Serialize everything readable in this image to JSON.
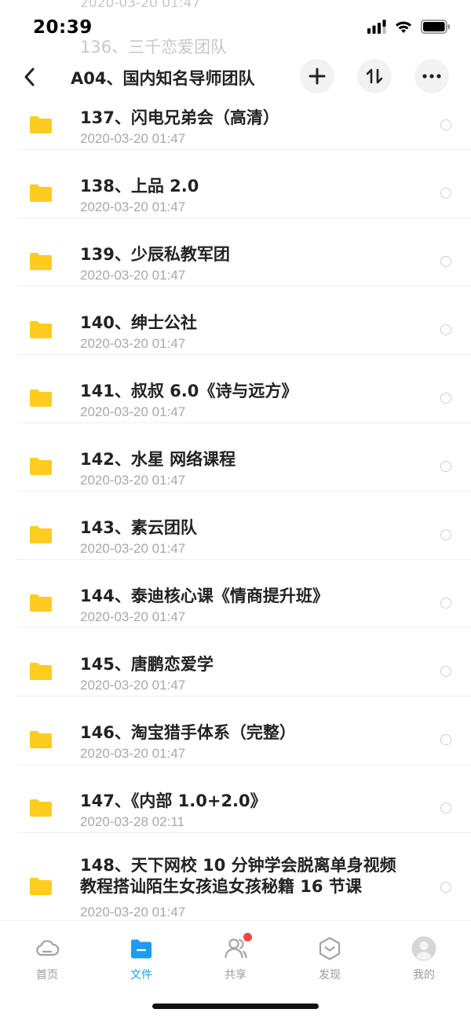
{
  "status_bar": {
    "time": "20:39"
  },
  "ghost_rows": {
    "top_date": "2020-03-20 01:47",
    "prev_item": "136、三千恋爱团队"
  },
  "header": {
    "title": "A04、国内知名导师团队"
  },
  "files": [
    {
      "name": "137、闪电兄弟会（高清）",
      "date": "2020-03-20 01:47"
    },
    {
      "name": "138、上品 2.0",
      "date": "2020-03-20 01:47"
    },
    {
      "name": "139、少辰私教军团",
      "date": "2020-03-20 01:47"
    },
    {
      "name": "140、绅士公社",
      "date": "2020-03-20 01:47"
    },
    {
      "name": "141、叔叔 6.0《诗与远方》",
      "date": "2020-03-20 01:47"
    },
    {
      "name": "142、水星 网络课程",
      "date": "2020-03-20 01:47"
    },
    {
      "name": "143、素云团队",
      "date": "2020-03-20 01:47"
    },
    {
      "name": "144、泰迪核心课《情商提升班》",
      "date": "2020-03-20 01:47"
    },
    {
      "name": "145、唐鹏恋爱学",
      "date": "2020-03-20 01:47"
    },
    {
      "name": "146、淘宝猎手体系（完整）",
      "date": "2020-03-20 01:47"
    },
    {
      "name": "147、《内部 1.0+2.0》",
      "date": "2020-03-28 02:11"
    },
    {
      "name": "148、天下网校 10 分钟学会脱离单身视频教程搭讪陌生女孩追女孩秘籍 16 节课",
      "date": "2020-03-20 01:47"
    }
  ],
  "tabs": [
    {
      "label": "首页",
      "icon": "cloud-icon"
    },
    {
      "label": "文件",
      "icon": "folder-icon",
      "active": true
    },
    {
      "label": "共享",
      "icon": "people-icon",
      "badge": true
    },
    {
      "label": "发现",
      "icon": "compass-icon"
    },
    {
      "label": "我的",
      "icon": "avatar-icon"
    }
  ],
  "colors": {
    "accent": "#1b9cf2",
    "folder": "#ffcc1f",
    "badge": "#f5434a"
  }
}
